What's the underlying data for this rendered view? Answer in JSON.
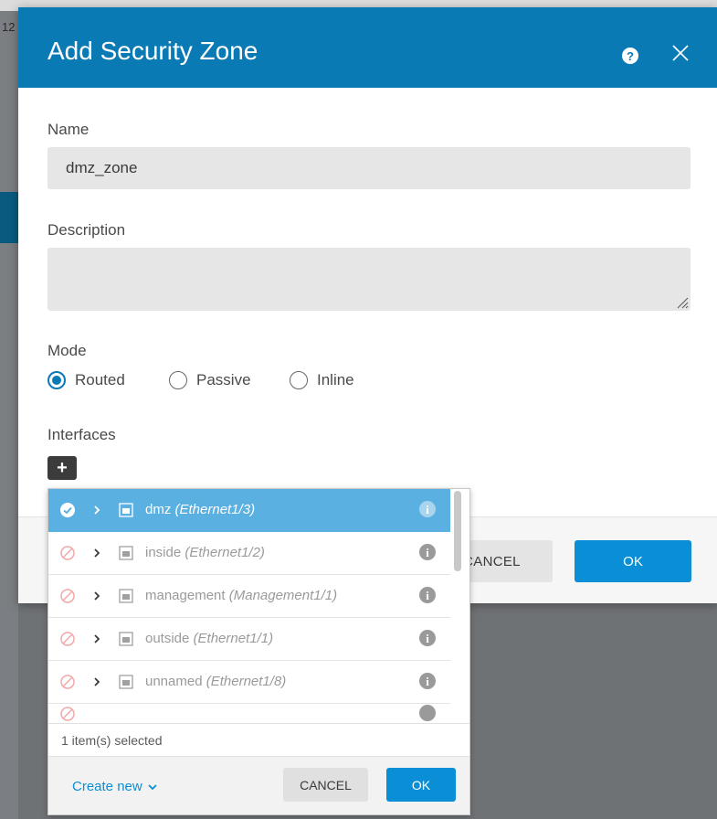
{
  "background": {
    "fragment_text": "12"
  },
  "dialog": {
    "title": "Add Security Zone",
    "header_color": "#0a7ab5",
    "help_icon": "help-icon",
    "close_icon": "close-icon",
    "name_label": "Name",
    "name_value": "dmz_zone",
    "description_label": "Description",
    "description_value": "",
    "mode_label": "Mode",
    "modes": [
      {
        "label": "Routed",
        "checked": true
      },
      {
        "label": "Passive",
        "checked": false
      },
      {
        "label": "Inline",
        "checked": false
      }
    ],
    "interfaces_label": "Interfaces",
    "add_label": "+",
    "cancel_label": "CANCEL",
    "ok_label": "OK"
  },
  "picker": {
    "items": [
      {
        "name": "dmz",
        "detail": "(Ethernet1/3)",
        "selected": true
      },
      {
        "name": "inside",
        "detail": "(Ethernet1/2)",
        "selected": false
      },
      {
        "name": "management",
        "detail": "(Management1/1)",
        "selected": false
      },
      {
        "name": "outside",
        "detail": "(Ethernet1/1)",
        "selected": false
      },
      {
        "name": "unnamed",
        "detail": "(Ethernet1/8)",
        "selected": false
      }
    ],
    "selection_count": "1 item(s) selected",
    "create_new_label": "Create new",
    "cancel_label": "CANCEL",
    "ok_label": "OK"
  },
  "colors": {
    "accent": "#0a8fd6",
    "selected_row": "#5bb0e2",
    "disabled_icon": "#f0a8a8"
  }
}
